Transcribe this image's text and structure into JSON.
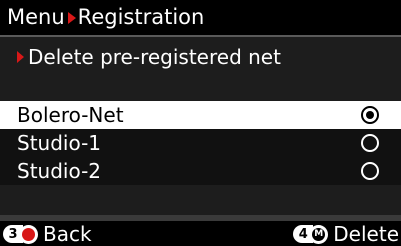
{
  "header": {
    "crumbs": [
      "Menu",
      "Registration"
    ],
    "arrow_color": "#d81818"
  },
  "subheading": "Delete pre-registered net",
  "list": {
    "items": [
      {
        "label": "Bolero-Net",
        "selected": true
      },
      {
        "label": "Studio-1",
        "selected": false
      },
      {
        "label": "Studio-2",
        "selected": false
      }
    ]
  },
  "footer": {
    "back": {
      "key": "3",
      "icon": "red-record-dot-icon",
      "label": "Back"
    },
    "delete": {
      "key": "4",
      "icon": "m-button-icon",
      "icon_text": "M",
      "label": "Delete"
    }
  }
}
